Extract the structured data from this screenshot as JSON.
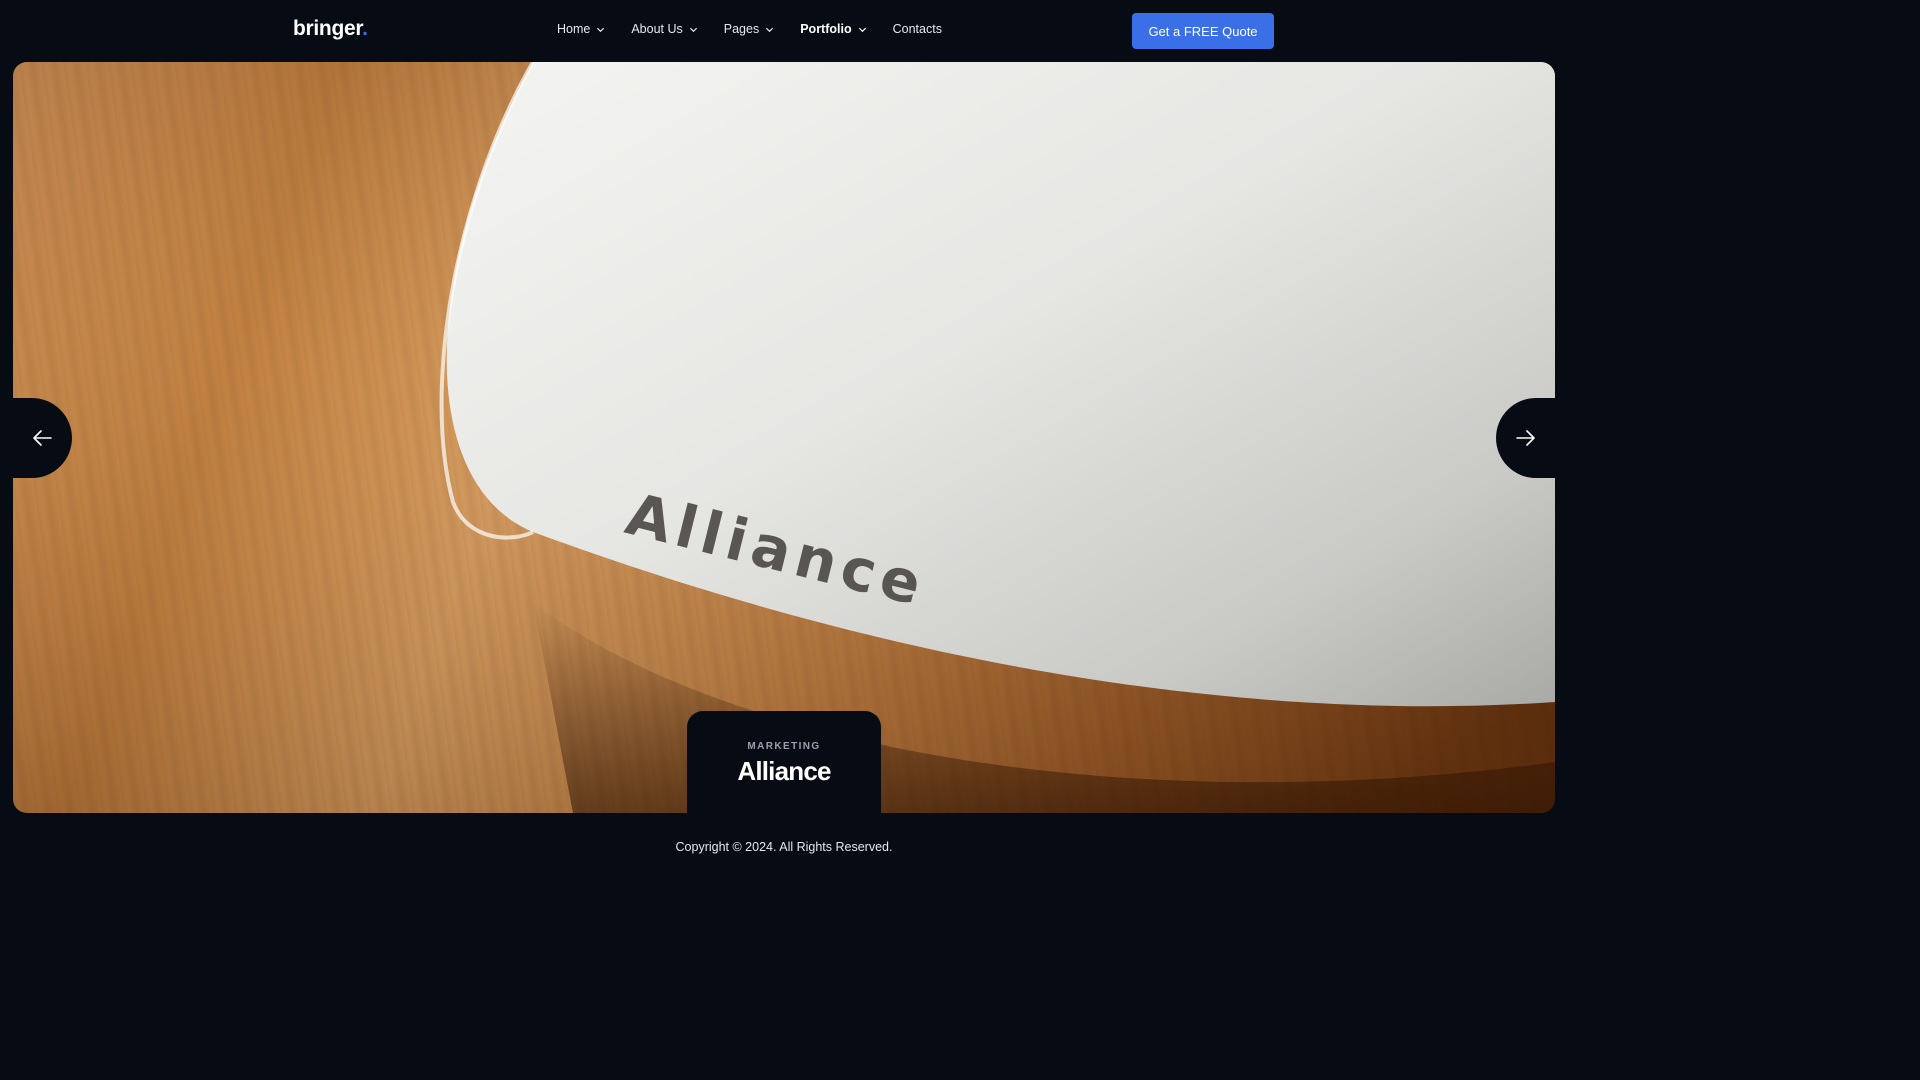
{
  "header": {
    "logo_text": "bringer",
    "logo_dot": ".",
    "nav": [
      {
        "label": "Home",
        "has_dropdown": true
      },
      {
        "label": "About Us",
        "has_dropdown": true
      },
      {
        "label": "Pages",
        "has_dropdown": true
      },
      {
        "label": "Portfolio",
        "has_dropdown": true,
        "active": true
      },
      {
        "label": "Contacts",
        "has_dropdown": false
      }
    ],
    "cta_label": "Get a FREE Quote"
  },
  "hero": {
    "category": "MARKETING",
    "title": "Alliance",
    "product_engraving": "Alliance",
    "prev_icon": "arrow-left-icon",
    "next_icon": "arrow-right-icon"
  },
  "footer": {
    "copyright": "Copyright © 2024. All Rights Reserved."
  },
  "colors": {
    "background": "#070b13",
    "accent": "#3b6fe8",
    "text": "#ffffff"
  }
}
